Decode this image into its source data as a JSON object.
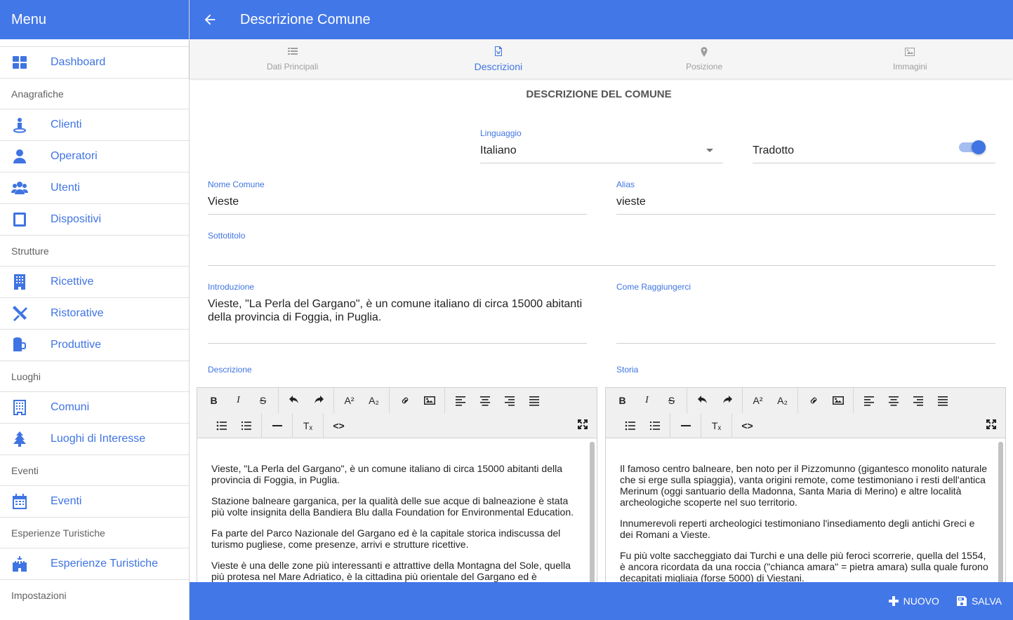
{
  "sidebar": {
    "title": "Menu",
    "dashboard": "Dashboard",
    "sections": {
      "anagrafiche": "Anagrafiche",
      "strutture": "Strutture",
      "luoghi": "Luoghi",
      "eventi": "Eventi",
      "esperienze": "Esperienze Turistiche",
      "impostazioni": "Impostazioni"
    },
    "items": {
      "clienti": "Clienti",
      "operatori": "Operatori",
      "utenti": "Utenti",
      "dispositivi": "Dispositivi",
      "ricettive": "Ricettive",
      "ristorative": "Ristorative",
      "produttive": "Produttive",
      "comuni": "Comuni",
      "luoghi_interesse": "Luoghi di Interesse",
      "eventi": "Eventi",
      "esperienze": "Esperienze Turistiche"
    }
  },
  "header": {
    "title": "Descrizione Comune"
  },
  "tabs": [
    {
      "label": "Dati Principali",
      "icon": "list-icon"
    },
    {
      "label": "Descrizioni",
      "icon": "document-icon",
      "active": true
    },
    {
      "label": "Posizione",
      "icon": "map-pin-icon"
    },
    {
      "label": "Immagini",
      "icon": "image-icon"
    }
  ],
  "form": {
    "section_title": "DESCRIZIONE DEL COMUNE",
    "language": {
      "label": "Linguaggio",
      "value": "Italiano"
    },
    "translated": {
      "label": "Tradotto",
      "checked": true
    },
    "name": {
      "label": "Nome Comune",
      "value": "Vieste"
    },
    "alias": {
      "label": "Alias",
      "value": "vieste"
    },
    "subtitle": {
      "label": "Sottotitolo",
      "value": ""
    },
    "intro": {
      "label": "Introduzione",
      "value": "Vieste, \"La Perla del Gargano\", è un comune italiano di circa 15000 abitanti della provincia di Foggia, in Puglia."
    },
    "how_to_reach": {
      "label": "Come Raggiungerci",
      "value": ""
    },
    "description": {
      "label": "Descrizione",
      "paragraphs": [
        "Vieste, \"La Perla del Gargano\", è un comune italiano di circa 15000 abitanti della provincia di Foggia, in Puglia.",
        "Stazione balneare garganica, per la qualità delle sue acque di balneazione è stata più volte insignita della Bandiera Blu dalla Foundation for Environmental Education.",
        "Fa parte del Parco Nazionale del Gargano ed è la capitale storica indiscussa del turismo pugliese, come presenze, arrivi e strutture ricettive.",
        "Vieste è una delle zone più interessanti e attrattive della Montagna del Sole, quella più protesa nel Mare Adriatico, è la cittadina più orientale del Gargano ed è"
      ]
    },
    "history": {
      "label": "Storia",
      "paragraphs": [
        "Il famoso centro balneare, ben noto per il Pizzomunno (gigantesco monolito naturale che si erge sulla spiaggia), vanta origini remote, come testimoniano i resti dell'antica Merinum (oggi santuario della Madonna, Santa Maria di Merino) e altre località archeologiche scoperte nel suo territorio.",
        "Innumerevoli reperti archeologici testimoniano l'insediamento degli antichi Greci e dei Romani a Vieste.",
        "Fu più volte saccheggiato dai Turchi e una delle più feroci scorrerie, quella del 1554, è ancora ricordata da una roccia (\"chianca amara\" = pietra amara) sulla quale furono decapitati migliaia (forse 5000) di Viestani."
      ]
    }
  },
  "editor_toolbar": {
    "bold": "B",
    "italic": "I",
    "strike": "S",
    "superscript": "A²",
    "subscript": "A₂",
    "clear_format": "Tₓ",
    "code": "<>"
  },
  "bottom": {
    "new_label": "NUOVO",
    "save_label": "SALVA"
  },
  "colors": {
    "primary": "#4277e8",
    "accent": "#3f74e2"
  }
}
